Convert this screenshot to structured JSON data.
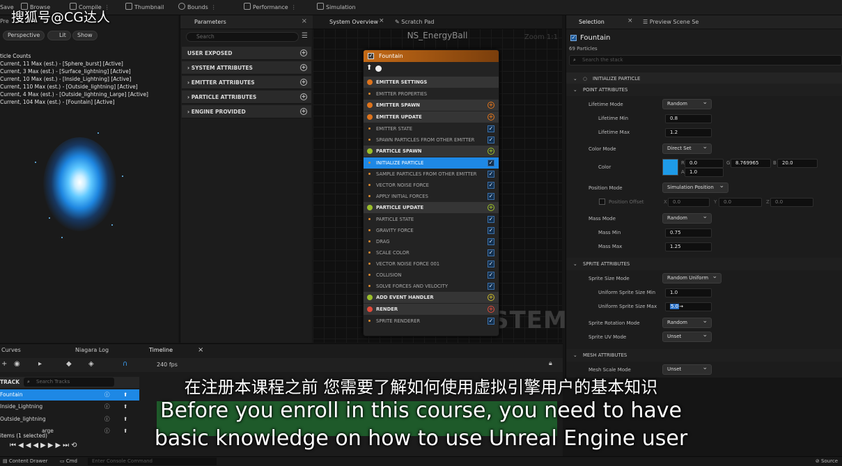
{
  "watermark": "搜狐号@CG达人",
  "toolbar": {
    "items": [
      "Save",
      "Browse",
      "Compile",
      "Thumbnail",
      "Bounds",
      "Performance",
      "Simulation"
    ]
  },
  "viewport": {
    "tab": "Pre",
    "buttons": [
      "Perspective",
      "Lit",
      "Show"
    ],
    "stats_title": "ticle Counts",
    "stats": [
      "Current, 11 Max (est.) - [Sphere_burst] [Active]",
      "Current, 3 Max (est.) - [Surface_lightning] [Active]",
      "Current, 10 Max (est.) - [Inside_Lightning] [Active]",
      "Current, 110 Max (est.) - [Outside_lightning] [Active]",
      "Current, 4 Max (est.) - [Outside_lightning_Large] [Active]",
      "Current, 104 Max (est.) - [Fountain] [Active]"
    ]
  },
  "parameters": {
    "tab": "Parameters",
    "search_placeholder": "Search",
    "groups": [
      "USER EXPOSED",
      "SYSTEM ATTRIBUTES",
      "EMITTER ATTRIBUTES",
      "PARTICLE ATTRIBUTES",
      "ENGINE PROVIDED"
    ]
  },
  "graph": {
    "tabs": [
      "System Overview",
      "Scratch Pad"
    ],
    "title": "NS_EnergyBall",
    "zoom": "Zoom 1:1",
    "watermark": "SYSTEM",
    "node_title": "Fountain",
    "rows": [
      {
        "label": "EMITTER SETTINGS",
        "kind": "sec",
        "icon": "#e0741c"
      },
      {
        "label": "EMITTER PROPERTIES",
        "kind": "item"
      },
      {
        "label": "EMITTER SPAWN",
        "kind": "sec",
        "icon": "#e0741c",
        "right": "plus-orange"
      },
      {
        "label": "EMITTER UPDATE",
        "kind": "sec",
        "icon": "#e0741c",
        "right": "plus-orange"
      },
      {
        "label": "EMITTER STATE",
        "kind": "item",
        "right": "check"
      },
      {
        "label": "SPAWN PARTICLES FROM OTHER EMITTER",
        "kind": "item",
        "right": "check"
      },
      {
        "label": "PARTICLE SPAWN",
        "kind": "sec",
        "icon": "#9bbf2a",
        "right": "plus-green"
      },
      {
        "label": "INITIALIZE PARTICLE",
        "kind": "sel",
        "right": "check"
      },
      {
        "label": "SAMPLE PARTICLES FROM OTHER EMITTER",
        "kind": "item",
        "right": "check"
      },
      {
        "label": "VECTOR NOISE FORCE",
        "kind": "item",
        "right": "check"
      },
      {
        "label": "APPLY INITIAL FORCES",
        "kind": "item",
        "right": "check"
      },
      {
        "label": "PARTICLE UPDATE",
        "kind": "sec",
        "icon": "#9bbf2a",
        "right": "plus-green"
      },
      {
        "label": "PARTICLE STATE",
        "kind": "item",
        "right": "check"
      },
      {
        "label": "GRAVITY FORCE",
        "kind": "item",
        "right": "check"
      },
      {
        "label": "DRAG",
        "kind": "item",
        "right": "check"
      },
      {
        "label": "SCALE COLOR",
        "kind": "item",
        "right": "check"
      },
      {
        "label": "VECTOR NOISE FORCE 001",
        "kind": "item",
        "right": "check"
      },
      {
        "label": "COLLISION",
        "kind": "item",
        "right": "check"
      },
      {
        "label": "SOLVE FORCES AND VELOCITY",
        "kind": "item",
        "right": "check"
      },
      {
        "label": "ADD EVENT HANDLER",
        "kind": "sec",
        "icon": "#9bbf2a",
        "right": "plus-yellow"
      },
      {
        "label": "RENDER",
        "kind": "sec",
        "icon": "#e04a3a",
        "right": "plus-red"
      },
      {
        "label": "SPRITE RENDERER",
        "kind": "item",
        "right": "check"
      }
    ]
  },
  "selection": {
    "tabs": [
      "Selection",
      "Preview Scene Se"
    ],
    "emitter": "Fountain",
    "particles": "69 Particles",
    "search_placeholder": "Search the stack",
    "module": "INITIALIZE PARTICLE",
    "point_attributes": "POINT ATTRIBUTES",
    "lifetime_mode_label": "Lifetime Mode",
    "lifetime_mode": "Random",
    "lifetime_min_label": "Lifetime Min",
    "lifetime_min": "0.8",
    "lifetime_max_label": "Lifetime Max",
    "lifetime_max": "1.2",
    "color_mode_label": "Color Mode",
    "color_mode": "Direct Set",
    "color_label": "Color",
    "color_swatch": "#1e9be8",
    "color_r_label": "R",
    "color_r": "0.0",
    "color_g_label": "G",
    "color_g": "8.769965",
    "color_b_label": "B",
    "color_b": "20.0",
    "color_a_label": "A",
    "color_a": "1.0",
    "position_mode_label": "Position Mode",
    "position_mode": "Simulation Position",
    "position_offset_label": "Position Offset",
    "offset_x_label": "X",
    "offset_x": "0.0",
    "offset_y_label": "Y",
    "offset_y": "0.0",
    "offset_z_label": "Z",
    "offset_z": "0.0",
    "mass_mode_label": "Mass Mode",
    "mass_mode": "Random",
    "mass_min_label": "Mass Min",
    "mass_min": "0.75",
    "mass_max_label": "Mass Max",
    "mass_max": "1.25",
    "sprite_attributes": "SPRITE ATTRIBUTES",
    "sprite_size_mode_label": "Sprite Size Mode",
    "sprite_size_mode": "Random Uniform",
    "uniform_min_label": "Uniform Sprite Size Min",
    "uniform_min": "1.0",
    "uniform_max_label": "Uniform Sprite Size Max",
    "uniform_max": "5.0",
    "rotation_mode_label": "Sprite Rotation Mode",
    "rotation_mode": "Random",
    "uv_mode_label": "Sprite UV Mode",
    "uv_mode": "Unset",
    "mesh_attributes": "MESH ATTRIBUTES",
    "mesh_scale_label": "Mesh Scale Mode",
    "mesh_scale": "Unset"
  },
  "timeline": {
    "tabs": [
      "Curves",
      "Niagara Log",
      "Timeline"
    ],
    "fps": "240 fps",
    "track_label": "TRACK",
    "search_placeholder": "Search Tracks",
    "tracks": [
      "Fountain",
      "Inside_Lightning",
      "Outside_lightning",
      "arge"
    ],
    "items_selected": "items (1 selected)"
  },
  "statusbar": {
    "content_drawer": "Content Drawer",
    "cmd": "Cmd",
    "console_placeholder": "Enter Console Command",
    "source": "Source"
  },
  "subtitles": {
    "zh": "在注册本课程之前 您需要了解如何使用虚拟引擎用户的基本知识",
    "en1": "Before you enroll in this course, you need to have",
    "en2": "basic knowledge on how to use Unreal Engine user"
  }
}
